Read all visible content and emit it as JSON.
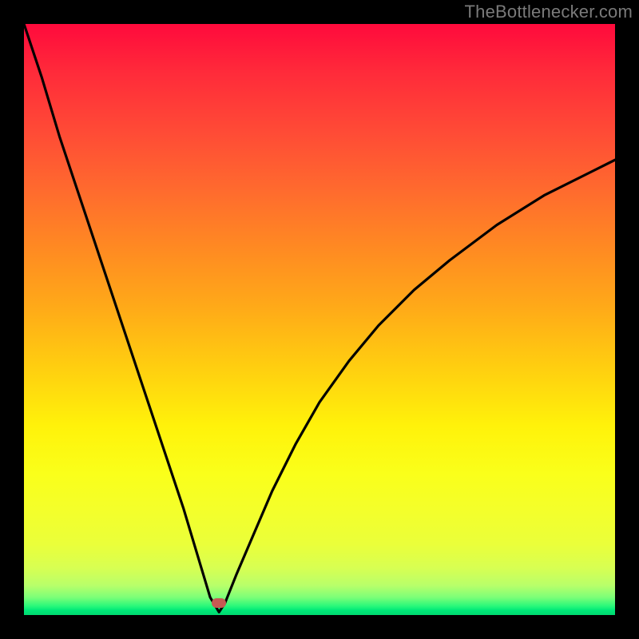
{
  "watermark": {
    "text": "TheBottlenecker.com"
  },
  "chart_data": {
    "type": "line",
    "title": "",
    "xlabel": "",
    "ylabel": "",
    "xlim": [
      0,
      100
    ],
    "ylim": [
      0,
      100
    ],
    "x": [
      0,
      3,
      6,
      9,
      12,
      15,
      18,
      21,
      24,
      27,
      30,
      31.5,
      33,
      34,
      36,
      39,
      42,
      46,
      50,
      55,
      60,
      66,
      72,
      80,
      88,
      96,
      100
    ],
    "values": [
      100,
      91,
      81,
      72,
      63,
      54,
      45,
      36,
      27,
      18,
      8,
      3,
      0.5,
      2,
      7,
      14,
      21,
      29,
      36,
      43,
      49,
      55,
      60,
      66,
      71,
      75,
      77
    ],
    "marker": {
      "x": 33,
      "y": 2
    },
    "grid": false,
    "legend": false
  },
  "colors": {
    "line": "#000000",
    "marker": "#c65a53",
    "frame": "#000000"
  }
}
